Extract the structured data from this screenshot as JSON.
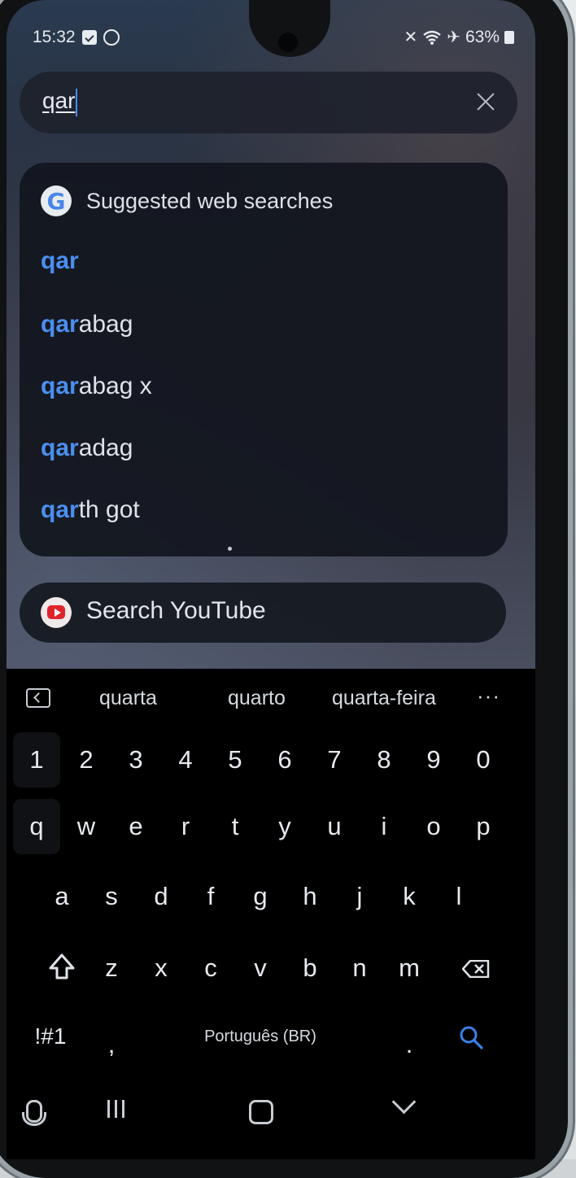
{
  "status_bar": {
    "time": "15:32",
    "battery": "63%",
    "icons": [
      "check-box-icon",
      "circle-icon",
      "mute-icon",
      "wifi-icon",
      "airplane-icon",
      "battery-icon"
    ]
  },
  "search": {
    "value": "qar"
  },
  "suggestions": {
    "header": "Suggested web searches",
    "items": [
      {
        "match": "qar",
        "rest": ""
      },
      {
        "match": "qar",
        "rest": "abag"
      },
      {
        "match": "qar",
        "rest": "abag x"
      },
      {
        "match": "qar",
        "rest": "adag"
      },
      {
        "match": "qar",
        "rest": "th got"
      }
    ]
  },
  "youtube": {
    "label": "Search YouTube"
  },
  "keyboard": {
    "predictions": [
      "quarta",
      "quarto",
      "quarta-feira"
    ],
    "more": "···",
    "numbers": [
      "1",
      "2",
      "3",
      "4",
      "5",
      "6",
      "7",
      "8",
      "9",
      "0"
    ],
    "row1": [
      "q",
      "w",
      "e",
      "r",
      "t",
      "y",
      "u",
      "i",
      "o",
      "p"
    ],
    "row2": [
      "a",
      "s",
      "d",
      "f",
      "g",
      "h",
      "j",
      "k",
      "l"
    ],
    "row3": [
      "z",
      "x",
      "c",
      "v",
      "b",
      "n",
      "m"
    ],
    "symbols_key": "!#1",
    "comma": ",",
    "space_label": "Português (BR)",
    "period": "."
  },
  "colors": {
    "highlight": "#4b8ff0",
    "accent": "#3b7fe6"
  }
}
